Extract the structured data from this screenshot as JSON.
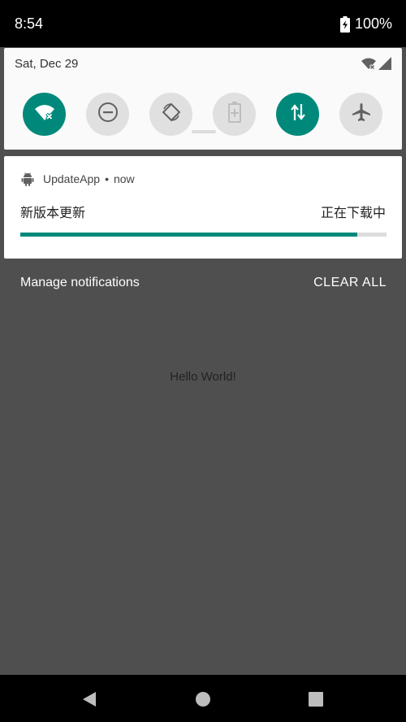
{
  "status_bar": {
    "time": "8:54",
    "battery": "100%",
    "icons": [
      "battery-charging-icon"
    ]
  },
  "quick_settings": {
    "date": "Sat, Dec 29",
    "status_icons": [
      "wifi-off-icon",
      "signal-icon"
    ],
    "tiles": [
      {
        "name": "wifi",
        "icon": "wifi-off-icon",
        "state": "on"
      },
      {
        "name": "do-not-disturb",
        "icon": "do-not-disturb-icon",
        "state": "off"
      },
      {
        "name": "auto-rotate",
        "icon": "auto-rotate-icon",
        "state": "off"
      },
      {
        "name": "battery-saver",
        "icon": "battery-saver-icon",
        "state": "off"
      },
      {
        "name": "mobile-data",
        "icon": "data-transfer-icon",
        "state": "on"
      },
      {
        "name": "airplane-mode",
        "icon": "airplane-icon",
        "state": "off"
      }
    ]
  },
  "notification": {
    "app_name": "UpdateApp",
    "separator": "•",
    "time": "now",
    "title": "新版本更新",
    "status": "正在下载中",
    "progress": 0.92
  },
  "actions": {
    "manage": "Manage notifications",
    "clear_all": "CLEAR ALL"
  },
  "app_content": {
    "text": "Hello World!"
  },
  "colors": {
    "accent": "#00897b",
    "tile_off": "#e0e0e0",
    "background": "#4f4f4f"
  },
  "nav": [
    "back-icon",
    "home-icon",
    "recents-icon"
  ]
}
